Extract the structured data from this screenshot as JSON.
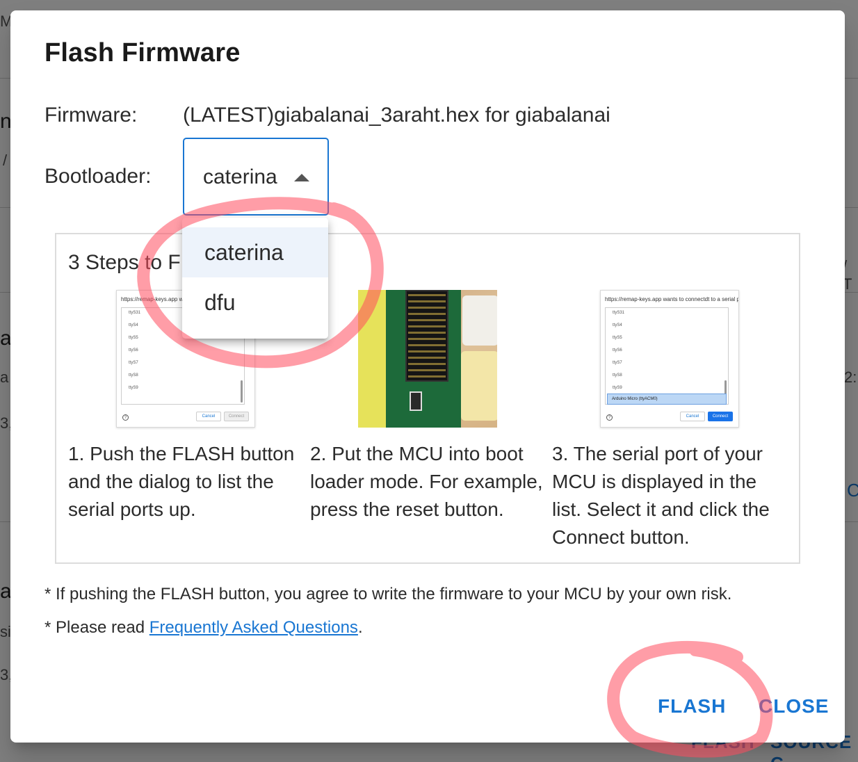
{
  "background": {
    "fragments": [
      "M",
      "n",
      "/",
      "a",
      "a",
      "3,",
      "a",
      "si",
      "3,",
      "/ T",
      "2:",
      "C"
    ],
    "footer": [
      "FLASH",
      "SOURCE C"
    ]
  },
  "dialog": {
    "title": "Flash Firmware",
    "firmware_label": "Firmware:",
    "firmware_value": "(LATEST)giabalanai_3araht.hex for giabalanai",
    "bootloader_label": "Bootloader:",
    "bootloader_selected": "caterina",
    "bootloader_options": [
      "caterina",
      "dfu"
    ],
    "steps_title": "3 Steps to F",
    "steps": [
      "1. Push the FLASH button and the dialog to list the serial ports up.",
      "2. Put the MCU into boot loader mode. For example, press the reset button.",
      "3. The serial port of your MCU is displayed in the list. Select it and click the Connect button."
    ],
    "thumb1": {
      "url": "https://remap-keys.app wan",
      "items": [
        "ttyS31",
        "ttyS4",
        "ttyS5",
        "ttyS6",
        "ttyS7",
        "ttyS8",
        "ttyS9"
      ],
      "cancel": "Cancel",
      "connect": "Connect"
    },
    "thumb3": {
      "url": "https://remap-keys.app wants to connectdt to a serial port",
      "items": [
        "ttyS31",
        "ttyS4",
        "ttyS5",
        "ttyS6",
        "ttyS7",
        "ttyS8",
        "ttyS9"
      ],
      "selected_item": "Arduino Micro  (ttyACM0)",
      "cancel": "Cancel",
      "connect": "Connect"
    },
    "note1": "* If pushing the FLASH button, you agree to write the firmware to your MCU by your own risk.",
    "note2_prefix": "* Please read ",
    "note2_link": "Frequently Asked Questions",
    "note2_suffix": ".",
    "flash_button": "FLASH",
    "close_button": "CLOSE"
  },
  "colors": {
    "accent": "#1976d2",
    "annotation": "#ff4d5e"
  }
}
